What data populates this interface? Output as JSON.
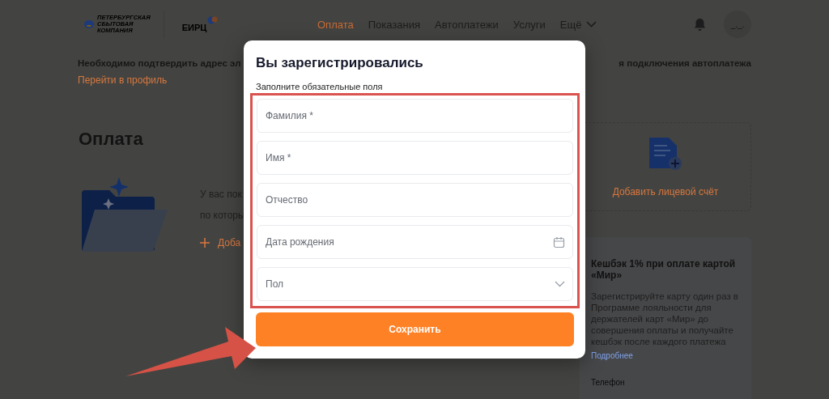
{
  "header": {
    "logo_lines": [
      "ПЕТЕРБУРГСКАЯ",
      "СБЫТОВАЯ",
      "КОМПАНИЯ"
    ],
    "logo_2": "ЕИРЦ",
    "nav": [
      {
        "label": "Оплата",
        "selected": true
      },
      {
        "label": "Показания",
        "selected": false
      },
      {
        "label": "Автоплатежи",
        "selected": false
      },
      {
        "label": "Услуги",
        "selected": false
      },
      {
        "label": "Ещё",
        "selected": false,
        "kind": "dropdown"
      }
    ],
    "avatar": "_._."
  },
  "notice": {
    "text_start": "Необходимо подтвердить адрес эл",
    "text_end": "я подключения автоплатежа",
    "link": "Перейти в профиль"
  },
  "page_title": "Оплата",
  "empty_state": {
    "lines": [
      "У вас пок",
      "по которы"
    ],
    "action": "Доба"
  },
  "add_account": {
    "label": "Добавить лицевой счёт"
  },
  "promo": {
    "title": "Кешбэк 1% при оплате картой «Мир»",
    "text": "Зарегистрируйте карту один раз в Программе лояльности для держателей карт «Мир» до совершения оплаты и получайте кешбэк после каждого платежа",
    "link": "Подробнее",
    "footer": "Телефон"
  },
  "modal": {
    "title": "Вы зарегистрировались",
    "subtitle": "Заполните обязательные поля",
    "fields": [
      {
        "placeholder": "Фамилия *",
        "kind": "text"
      },
      {
        "placeholder": "Имя *",
        "kind": "text"
      },
      {
        "placeholder": "Отчество",
        "kind": "text"
      },
      {
        "placeholder": "Дата рождения",
        "kind": "date"
      },
      {
        "placeholder": "Пол",
        "kind": "select"
      }
    ],
    "button": "Сохранить"
  }
}
